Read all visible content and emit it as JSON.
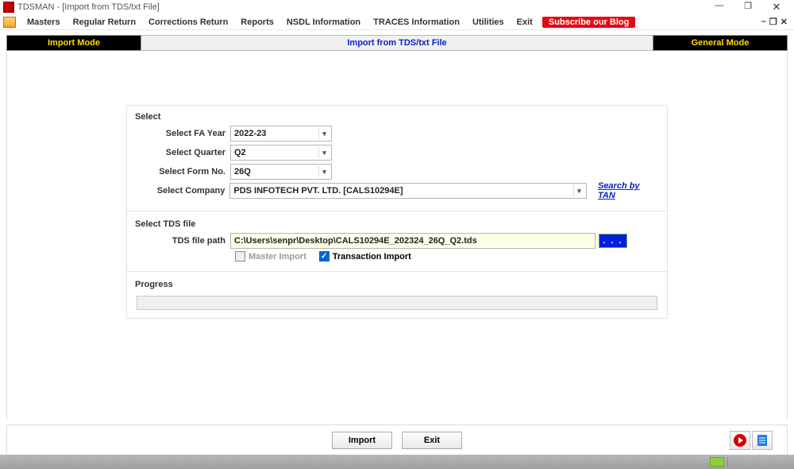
{
  "window": {
    "title": "TDSMAN - [Import from TDS/txt File]"
  },
  "menu": {
    "items": [
      "Masters",
      "Regular Return",
      "Corrections Return",
      "Reports",
      "NSDL Information",
      "TRACES Information",
      "Utilities",
      "Exit"
    ],
    "blog": "Subscribe our Blog",
    "right_minus": "–",
    "right_restore": "❐",
    "right_close": "✕"
  },
  "tabs": {
    "import": "Import Mode",
    "title": "Import from TDS/txt File",
    "general": "General Mode"
  },
  "select": {
    "legend": "Select",
    "fa_year_label": "Select FA Year",
    "fa_year_value": "2022-23",
    "quarter_label": "Select Quarter",
    "quarter_value": "Q2",
    "form_label": "Select Form No.",
    "form_value": "26Q",
    "company_label": "Select Company",
    "company_value": "PDS INFOTECH PVT. LTD. [CALS10294E]",
    "search_tan": "Search by TAN"
  },
  "tdsfile": {
    "legend": "Select TDS file",
    "path_label": "TDS file path",
    "path_value": "C:\\Users\\senpr\\Desktop\\CALS10294E_202324_26Q_Q2.tds",
    "browse": ". . .",
    "master_import": "Master Import",
    "transaction_import": "Transaction Import"
  },
  "progress": {
    "legend": "Progress"
  },
  "footer": {
    "import": "Import",
    "exit": "Exit"
  },
  "winbtns": {
    "min": "—",
    "max": "❐",
    "close": "✕"
  }
}
